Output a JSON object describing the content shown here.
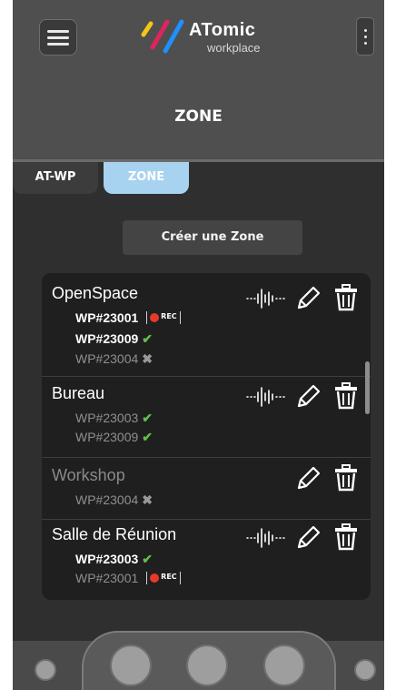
{
  "header": {
    "logo_main": "ATomic",
    "logo_sub": "workplace",
    "title": "ZONE"
  },
  "tabs": [
    {
      "label": "AT-WP",
      "active": false
    },
    {
      "label": "ZONE",
      "active": true
    }
  ],
  "create_button": "Créer une Zone",
  "rec_label": "REC",
  "zones": [
    {
      "name": "OpenSpace",
      "enabled": true,
      "has_audio": true,
      "workplaces": [
        {
          "id": "WP#23001",
          "online": true,
          "status": "rec"
        },
        {
          "id": "WP#23009",
          "online": true,
          "status": "ok"
        },
        {
          "id": "WP#23004",
          "online": false,
          "status": "ko"
        }
      ]
    },
    {
      "name": "Bureau",
      "enabled": true,
      "has_audio": true,
      "workplaces": [
        {
          "id": "WP#23003",
          "online": false,
          "status": "ok"
        },
        {
          "id": "WP#23009",
          "online": false,
          "status": "ok"
        }
      ]
    },
    {
      "name": "Workshop",
      "enabled": false,
      "has_audio": false,
      "workplaces": [
        {
          "id": "WP#23004",
          "online": false,
          "status": "ko"
        }
      ]
    },
    {
      "name": "Salle de Réunion",
      "enabled": true,
      "has_audio": true,
      "workplaces": [
        {
          "id": "WP#23003",
          "online": true,
          "status": "ok"
        },
        {
          "id": "WP#23001",
          "online": false,
          "status": "rec"
        }
      ]
    }
  ],
  "icons": {
    "menu": "hamburger-menu-icon",
    "more": "kebab-menu-icon",
    "audio": "sound-wave-icon",
    "edit": "pencil-icon",
    "delete": "trash-icon",
    "ok": "check-icon",
    "ko": "cross-icon",
    "rec": "record-icon"
  },
  "colors": {
    "accent": "#a8d3f0",
    "ok": "#5fc048",
    "rec": "#e53a2a",
    "logo_stripes": [
      "#f5c518",
      "#e0245e",
      "#1e90ff"
    ]
  }
}
